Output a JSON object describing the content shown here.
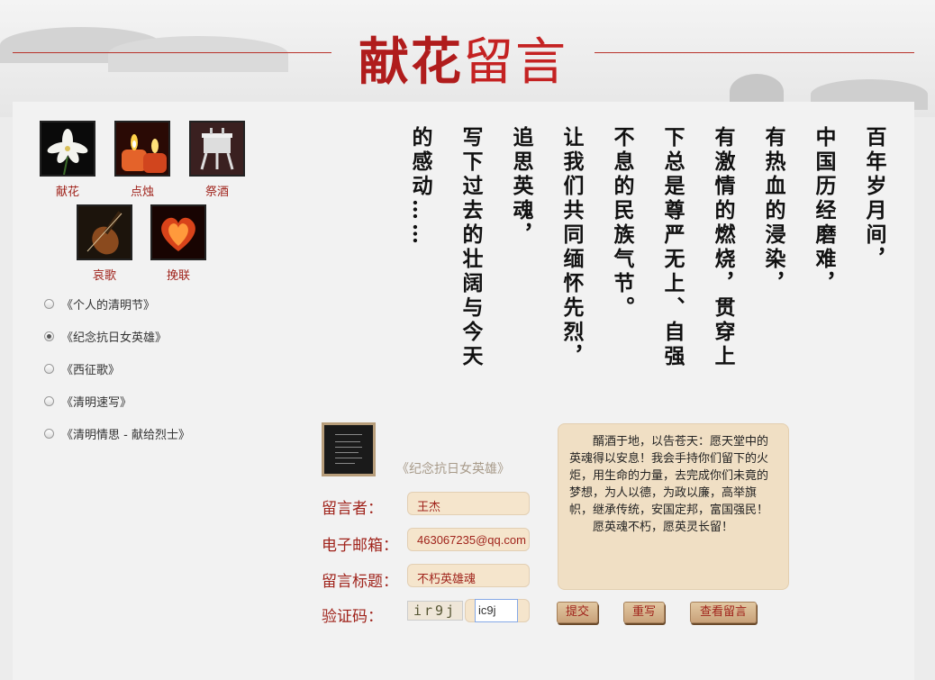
{
  "header": {
    "title_part1": "献花",
    "title_part2": "留言"
  },
  "offerings": [
    {
      "label": "献花",
      "icon": "lily-flower-icon"
    },
    {
      "label": "点烛",
      "icon": "candle-icon"
    },
    {
      "label": "祭酒",
      "icon": "wine-vessel-icon"
    },
    {
      "label": "哀歌",
      "icon": "violin-icon"
    },
    {
      "label": "挽联",
      "icon": "heart-candle-icon"
    }
  ],
  "songs": [
    {
      "label": "《个人的清明节》",
      "selected": false
    },
    {
      "label": "《纪念抗日女英雄》",
      "selected": true
    },
    {
      "label": "《西征歌》",
      "selected": false
    },
    {
      "label": "《清明速写》",
      "selected": false
    },
    {
      "label": "《清明情思 - 献给烈士》",
      "selected": false
    }
  ],
  "poem": [
    "百年岁月间，",
    "中国历经磨难，",
    "有热血的浸染，",
    "有激情的燃烧，贯穿上",
    "下总是尊严无上、自强",
    "不息的民族气节。",
    "让我们共同缅怀先烈，",
    "追思英魂，",
    "写下过去的壮阔与今天",
    "的感动……"
  ],
  "form": {
    "selected_song": "《纪念抗日女英雄》",
    "name_label": "留言者：",
    "name_value": "王杰",
    "email_label": "电子邮箱：",
    "email_value": "463067235@qq.com",
    "subject_label": "留言标题：",
    "subject_value": "不朽英雄魂",
    "captcha_label": "验证码：",
    "captcha_image_text": "ir9j",
    "captcha_value": "ic9j",
    "message_p1": "醑酒于地，以告苍天：愿天堂中的英魂得以安息！我会手持你们留下的火炬，用生命的力量，去完成你们未竟的梦想，为人以德，为政以廉，高举旗帜，继承传统，安国定邦，富国强民！",
    "message_p2": "愿英魂不朽，愿英灵长留！",
    "submit": "提交",
    "reset": "重写",
    "view": "查看留言"
  },
  "colors": {
    "accent": "#a0241c",
    "input_bg": "#f5e5cc",
    "button_bg": "#d4b08a"
  }
}
